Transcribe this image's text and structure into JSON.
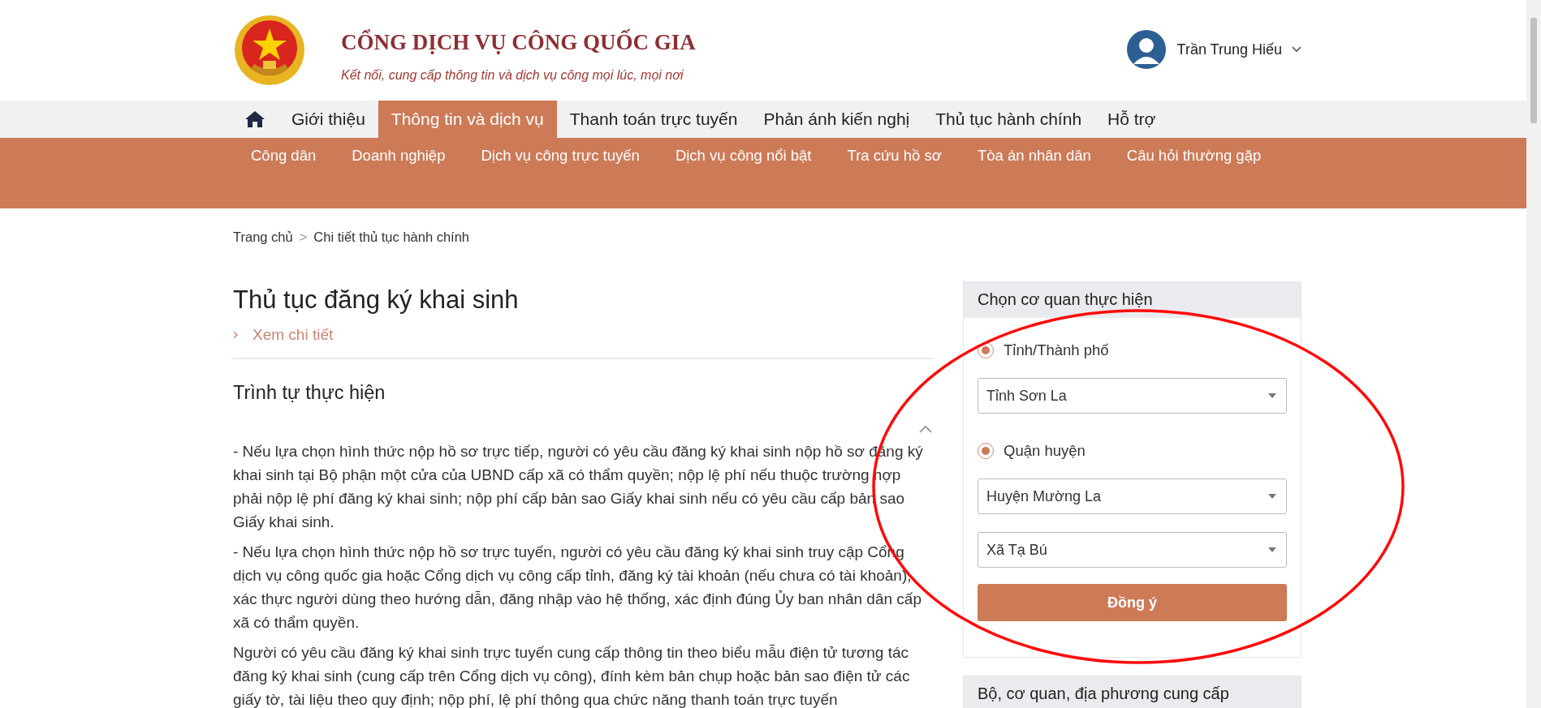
{
  "header": {
    "title": "CỔNG DỊCH VỤ CÔNG QUỐC GIA",
    "tagline": "Kết nối, cung cấp thông tin và dịch vụ công mọi lúc, mọi nơi",
    "user": {
      "name": "Trần Trung Hiếu"
    }
  },
  "nav": [
    {
      "label": "Giới thiệu",
      "selected": false
    },
    {
      "label": "Thông tin và dịch vụ",
      "selected": true
    },
    {
      "label": "Thanh toán trực tuyến",
      "selected": false
    },
    {
      "label": "Phản ánh kiến nghị",
      "selected": false
    },
    {
      "label": "Thủ tục hành chính",
      "selected": false
    },
    {
      "label": "Hỗ trợ",
      "selected": false
    }
  ],
  "submenu": [
    "Công dân",
    "Doanh nghiệp",
    "Dịch vụ công trực tuyến",
    "Dịch vụ công nổi bật",
    "Tra cứu hồ sơ",
    "Tòa án nhân dân",
    "Câu hỏi thường gặp"
  ],
  "breadcrumb": {
    "items": [
      "Trang chủ",
      "Chi tiết thủ tục hành chính"
    ],
    "separator": ">"
  },
  "procedure": {
    "title": "Thủ tục đăng ký khai sinh",
    "detail_link": "Xem chi tiết",
    "section": {
      "title": "Trình tự thực hiện",
      "expanded": true,
      "paragraphs": [
        "- Nếu lựa chọn hình thức nộp hồ sơ trực tiếp, người có yêu cầu đăng ký khai sinh nộp hồ sơ đăng ký khai sinh tại Bộ phận một cửa của UBND cấp xã có thẩm quyền; nộp lệ phí nếu thuộc trường hợp phải nộp lệ phí đăng ký khai sinh; nộp phí cấp bản sao Giấy khai sinh nếu có yêu cầu cấp bản sao Giấy khai sinh.",
        "- Nếu lựa chọn hình thức nộp hồ sơ trực tuyến, người có yêu cầu đăng ký khai sinh truy cập Cổng dịch vụ công quốc gia hoặc Cổng dịch vụ công cấp tỉnh, đăng ký tài khoản (nếu chưa có tài khoản), xác thực người dùng theo hướng dẫn, đăng nhập vào hệ thống, xác định đúng Ủy ban nhân dân cấp xã có thẩm quyền.",
        "Người có yêu cầu đăng ký khai sinh trực tuyến cung cấp thông tin theo biểu mẫu điện tử tương tác đăng ký khai sinh (cung cấp trên Cổng dịch vụ công), đính kèm bản chụp hoặc bản sao điện tử các giấy tờ, tài liệu theo quy định; nộp phí, lệ phí thông qua chức năng thanh toán trực tuyến"
      ]
    }
  },
  "agency_panel": {
    "title": "Chọn cơ quan thực hiện",
    "fields": [
      {
        "kind": "radio",
        "label": "Tỉnh/Thành phố",
        "checked": true
      },
      {
        "kind": "select",
        "value": "Tỉnh Sơn La"
      },
      {
        "kind": "radio",
        "label": "Quận huyện",
        "checked": true
      },
      {
        "kind": "select",
        "value": "Huyện Mường La"
      },
      {
        "kind": "select",
        "value": "Xã Tạ Bú"
      }
    ],
    "button": "Đồng ý"
  },
  "provider_panel": {
    "title": "Bộ, cơ quan, địa phương cung cấp"
  },
  "annotations": [
    {
      "kind": "ellipse"
    }
  ]
}
